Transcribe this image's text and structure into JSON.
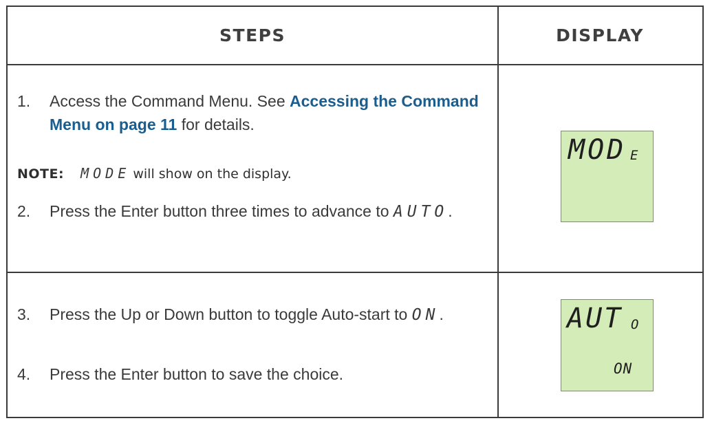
{
  "table": {
    "headers": {
      "steps": "STEPS",
      "display": "DISPLAY"
    }
  },
  "rows": [
    {
      "step1": {
        "number": "1.",
        "text_before": "Access the Command Menu. See ",
        "link": "Accessing the Command Menu on page 11",
        "text_after": " for details."
      },
      "note": {
        "label": "NOTE:",
        "display_word": "MODE",
        "text": " will show on the display."
      },
      "step2": {
        "number": "2.",
        "text": "Press the Enter button three times to advance to ",
        "display_word": "AUTO",
        "suffix": "."
      },
      "lcd": {
        "main": "MOD",
        "small": "E"
      }
    },
    {
      "step3": {
        "number": "3.",
        "text": "Press the Up or Down button to toggle Auto-start to ",
        "display_word": "ON",
        "suffix": "."
      },
      "step4": {
        "number": "4.",
        "text": "Press the Enter button to save the choice."
      },
      "lcd": {
        "main": "AUT",
        "small": "O",
        "sub": "ON"
      }
    }
  ],
  "colors": {
    "lcd_background": "#d4ecb8",
    "link": "#1a5d8f",
    "border": "#3a3a3a"
  }
}
